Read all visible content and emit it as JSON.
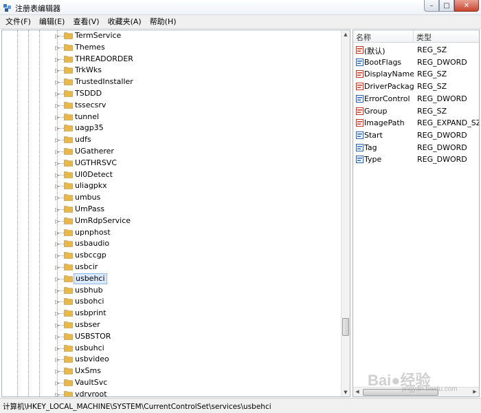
{
  "window": {
    "title": "注册表编辑器",
    "min": "–",
    "max": "□",
    "close": "✕"
  },
  "menu": [
    "文件(F)",
    "编辑(E)",
    "查看(V)",
    "收藏夹(A)",
    "帮助(H)"
  ],
  "tree": {
    "nodes": [
      "TermService",
      "Themes",
      "THREADORDER",
      "TrkWks",
      "TrustedInstaller",
      "TSDDD",
      "tssecsrv",
      "tunnel",
      "uagp35",
      "udfs",
      "UGatherer",
      "UGTHRSVC",
      "UI0Detect",
      "uliagpkx",
      "umbus",
      "UmPass",
      "UmRdpService",
      "upnphost",
      "usbaudio",
      "usbccgp",
      "usbcir",
      "usbehci",
      "usbhub",
      "usbohci",
      "usbprint",
      "usbser",
      "USBSTOR",
      "usbuhci",
      "usbvideo",
      "UxSms",
      "VaultSvc",
      "vdrvroot"
    ],
    "selected": "usbehci",
    "expander": "▷"
  },
  "values": {
    "headers": {
      "name": "名称",
      "type": "类型"
    },
    "rows": [
      {
        "name": "(默认)",
        "type": "REG_SZ",
        "kind": "string"
      },
      {
        "name": "BootFlags",
        "type": "REG_DWORD",
        "kind": "binary"
      },
      {
        "name": "DisplayName",
        "type": "REG_SZ",
        "kind": "string"
      },
      {
        "name": "DriverPackageId",
        "type": "REG_SZ",
        "kind": "string"
      },
      {
        "name": "ErrorControl",
        "type": "REG_DWORD",
        "kind": "binary"
      },
      {
        "name": "Group",
        "type": "REG_SZ",
        "kind": "string"
      },
      {
        "name": "ImagePath",
        "type": "REG_EXPAND_SZ",
        "kind": "string"
      },
      {
        "name": "Start",
        "type": "REG_DWORD",
        "kind": "binary"
      },
      {
        "name": "Tag",
        "type": "REG_DWORD",
        "kind": "binary"
      },
      {
        "name": "Type",
        "type": "REG_DWORD",
        "kind": "binary"
      }
    ]
  },
  "status": {
    "path": "计算机\\HKEY_LOCAL_MACHINE\\SYSTEM\\CurrentControlSet\\services\\usbehci"
  },
  "watermark": {
    "main": "Bai●经验",
    "sub": "jingyan.baidu.com"
  },
  "colors": {
    "folder": "#e8b84a",
    "selection": "#d9e8fb",
    "string_icon": "#c0392b",
    "binary_icon": "#2e5fa8"
  }
}
